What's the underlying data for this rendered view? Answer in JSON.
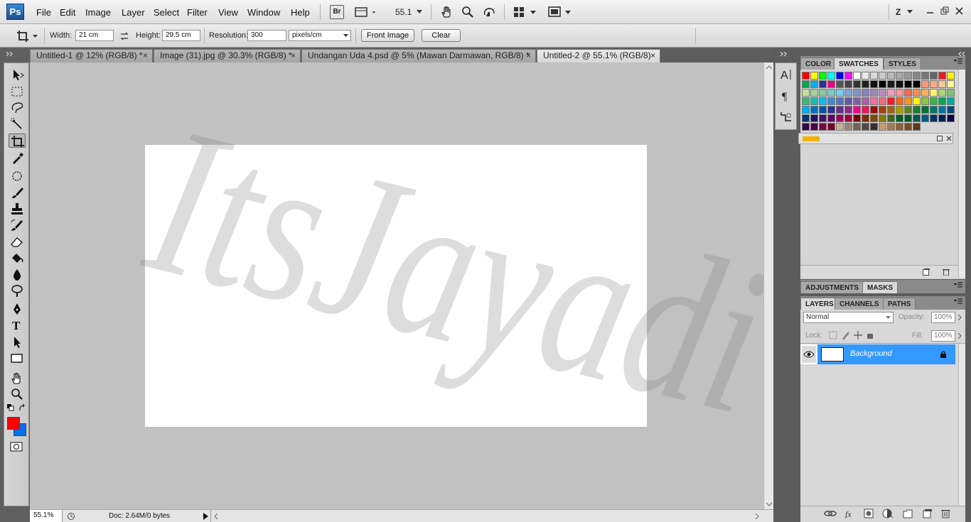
{
  "app": {
    "logo": "Ps"
  },
  "menu": {
    "items": [
      "File",
      "Edit",
      "Image",
      "Layer",
      "Select",
      "Filter",
      "View",
      "Window",
      "Help"
    ],
    "bridge_label": "Br",
    "zoom_value": "55.1",
    "workspace_label": "Z"
  },
  "options": {
    "width_label": "Width:",
    "width_value": "21 cm",
    "height_label": "Height:",
    "height_value": "29.5 cm",
    "resolution_label": "Resolution:",
    "resolution_value": "300",
    "resolution_unit": "pixels/cm",
    "front_image_label": "Front Image",
    "clear_label": "Clear"
  },
  "tabs": [
    {
      "label": "Untitled-1 @ 12% (RGB/8) *",
      "active": false
    },
    {
      "label": "Image (31).jpg @ 30.3% (RGB/8) *",
      "active": false
    },
    {
      "label": "Undangan Uda 4.psd @ 5% (Mawan Darmawan, RGB/8) *",
      "active": false
    },
    {
      "label": "Untitled-2 @ 55.1% (RGB/8)",
      "active": true
    }
  ],
  "tab_close_glyph": "×",
  "canvas": {
    "watermark_text": "ItsJayadi"
  },
  "status": {
    "zoom": "55.1%",
    "doc_info": "Doc: 2.64M/0 bytes"
  },
  "color_panel": {
    "tabs": [
      "COLOR",
      "SWATCHES",
      "STYLES"
    ],
    "active": "SWATCHES"
  },
  "swatch_rows": [
    [
      "#ff0000",
      "#ffff00",
      "#00ff00",
      "#00ffff",
      "#0000ff",
      "#ff00ff",
      "#ffffff",
      "#ebebeb",
      "#dadada",
      "#cacaca",
      "#b9b9b9",
      "#a8a8a8",
      "#989898",
      "#878787",
      "#777777",
      "#666666",
      "#ed1c24",
      "#fff200"
    ],
    [
      "#00a651",
      "#00aeef",
      "#2e3192",
      "#ec008c",
      "#555555",
      "#444444",
      "#333333",
      "#222222",
      "#111111",
      "#000000",
      "#1a1a1a",
      "#0d0d0d",
      "#000000",
      "#000000",
      "#f7977a",
      "#fbad82",
      "#fdc68c",
      "#fff799"
    ],
    [
      "#c4df9b",
      "#a3d39c",
      "#82ca9c",
      "#7accc8",
      "#6dcff6",
      "#7da7d8",
      "#8393ca",
      "#8781bd",
      "#a187be",
      "#bc8cbf",
      "#f49ac1",
      "#f6989d",
      "#f26c4f",
      "#f68e56",
      "#fbaf5d",
      "#fff467",
      "#acd372",
      "#7cc576"
    ],
    [
      "#3bb878",
      "#1abbb4",
      "#00bff3",
      "#438cca",
      "#5574b9",
      "#605ca8",
      "#855fa8",
      "#a763a8",
      "#f06eaa",
      "#f26d7d",
      "#ed1c24",
      "#f26522",
      "#f7941d",
      "#fff200",
      "#8dc73f",
      "#39b54a",
      "#00a651",
      "#00a99d"
    ],
    [
      "#00aeef",
      "#0072bc",
      "#0054a6",
      "#2e3192",
      "#662d91",
      "#92278f",
      "#ec008c",
      "#ed145b",
      "#9e0b0f",
      "#a0410d",
      "#a36209",
      "#aba000",
      "#598527",
      "#197b30",
      "#007236",
      "#00746b",
      "#0076a3",
      "#004b80"
    ],
    [
      "#003471",
      "#1b1464",
      "#440e62",
      "#630460",
      "#9e005d",
      "#9e0039",
      "#790000",
      "#7b2e00",
      "#7d4900",
      "#827b00",
      "#406618",
      "#005e20",
      "#005826",
      "#005952",
      "#005b7f",
      "#003663",
      "#002157",
      "#0d004c"
    ],
    [
      "#32004b",
      "#4b0049",
      "#7b0046",
      "#7a0026",
      "#c7b299",
      "#998675",
      "#736357",
      "#534741",
      "#37302a",
      "#c69c6d",
      "#a67c52",
      "#8c6239",
      "#754c24",
      "#603913"
    ]
  ],
  "adjust_panel": {
    "tabs": [
      "ADJUSTMENTS",
      "MASKS"
    ],
    "active": "MASKS"
  },
  "layers_panel": {
    "tabs": [
      "LAYERS",
      "CHANNELS",
      "PATHS"
    ],
    "active": "LAYERS",
    "blend_mode": "Normal",
    "opacity_label": "Opacity:",
    "opacity_value": "100%",
    "lock_label": "Lock:",
    "fill_label": "Fill:",
    "fill_value": "100%",
    "layer_name": "Background"
  },
  "colors": {
    "foreground": "#ff0000",
    "background": "#0070f0",
    "selection": "#3399ff",
    "canvas_bg": "#c1c1c1"
  }
}
